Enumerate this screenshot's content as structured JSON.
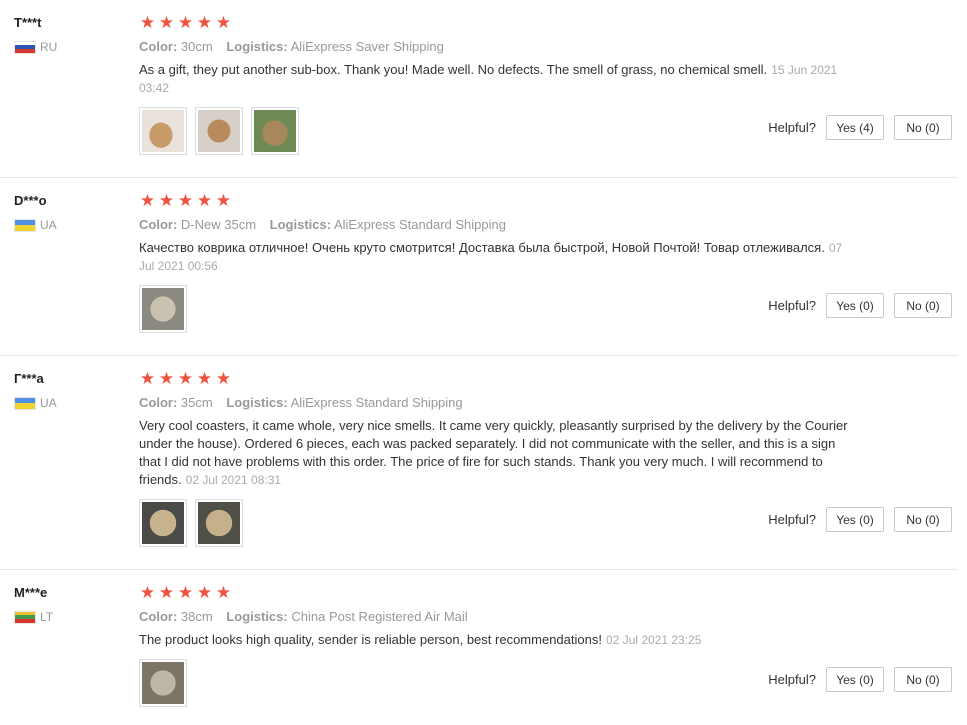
{
  "reviews": [
    {
      "user": "T***t",
      "country": "RU",
      "flag_colors": [
        "#ffffff",
        "#2d57b8",
        "#d8372f"
      ],
      "stars": 5,
      "color_label": "Color:",
      "color_value": "30cm",
      "logistics_label": "Logistics:",
      "logistics_value": "AliExpress Saver Shipping",
      "text": "As a gift, they put another sub-box. Thank you! Made well. No defects. The smell of grass, no chemical smell.",
      "date": "15 Jun 2021 03:42",
      "photos": [
        "photo-1",
        "photo-2",
        "photo-3"
      ],
      "helpful_label": "Helpful?",
      "yes_label": "Yes (4)",
      "no_label": "No (0)"
    },
    {
      "user": "D***o",
      "country": "UA",
      "flag_colors": [
        "#4f8fe6",
        "#f2d430"
      ],
      "stars": 5,
      "color_label": "Color:",
      "color_value": "D-New 35cm",
      "logistics_label": "Logistics:",
      "logistics_value": "AliExpress Standard Shipping",
      "text": "Качество коврика отличное! Очень круто смотрится! Доставка была быстрой, Новой Почтой! Товар отлеживался.",
      "date": "07 Jul 2021 00:56",
      "photos": [
        "photo-1"
      ],
      "helpful_label": "Helpful?",
      "yes_label": "Yes (0)",
      "no_label": "No (0)"
    },
    {
      "user": "Г***а",
      "country": "UA",
      "flag_colors": [
        "#4f8fe6",
        "#f2d430"
      ],
      "stars": 5,
      "color_label": "Color:",
      "color_value": "35cm",
      "logistics_label": "Logistics:",
      "logistics_value": "AliExpress Standard Shipping",
      "text": "Very cool coasters, it came whole, very nice smells. It came very quickly, pleasantly surprised by the delivery by the Courier under the house). Ordered 6 pieces, each was packed separately. I did not communicate with the seller, and this is a sign that I did not have problems with this order. The price of fire for such stands. Thank you very much. I will recommend to friends.",
      "date": "02 Jul 2021 08:31",
      "photos": [
        "photo-1",
        "photo-2"
      ],
      "helpful_label": "Helpful?",
      "yes_label": "Yes (0)",
      "no_label": "No (0)"
    },
    {
      "user": "M***e",
      "country": "LT",
      "flag_colors": [
        "#f2c230",
        "#3f9b4a",
        "#d8372f"
      ],
      "stars": 5,
      "color_label": "Color:",
      "color_value": "38cm",
      "logistics_label": "Logistics:",
      "logistics_value": "China Post Registered Air Mail",
      "text": "The product looks high quality, sender is reliable person, best recommendations!",
      "date": "02 Jul 2021 23:25",
      "photos": [
        "photo-1"
      ],
      "helpful_label": "Helpful?",
      "yes_label": "Yes (0)",
      "no_label": "No (0)"
    }
  ],
  "colors": {
    "star": "#f0533f",
    "muted": "#999999",
    "divider": "#e8e8e8"
  }
}
